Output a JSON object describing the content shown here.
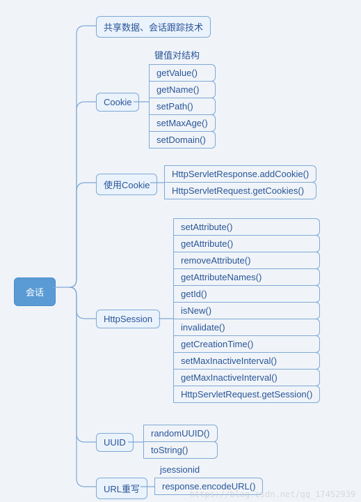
{
  "root": {
    "label": "会话"
  },
  "branch1": {
    "label": "共享数据、会话跟踪技术"
  },
  "branch2": {
    "label": "Cookie",
    "title": "键值对结构",
    "leaves": [
      "getValue()",
      "getName()",
      "setPath()",
      "setMaxAge()",
      "setDomain()"
    ]
  },
  "branch3": {
    "label": "使用Cookie",
    "leaves": [
      "HttpServletResponse.addCookie()",
      "HttpServletRequest.getCookies()"
    ]
  },
  "branch4": {
    "label": "HttpSession",
    "leaves": [
      "setAttribute()",
      "getAttribute()",
      "removeAttribute()",
      "getAttributeNames()",
      "getId()",
      "isNew()",
      "invalidate()",
      "getCreationTime()",
      "setMaxInactiveInterval()",
      "getMaxInactiveInterval()",
      "HttpServletRequest.getSession()"
    ]
  },
  "branch5": {
    "label": "UUID",
    "leaves": [
      "randomUUID()",
      "toString()"
    ]
  },
  "branch6": {
    "label": "URL重写",
    "title": "jsessionid",
    "leaves": [
      "response.encodeURL()"
    ]
  },
  "watermark": "https://blog.csdn.net/qq_17452939"
}
